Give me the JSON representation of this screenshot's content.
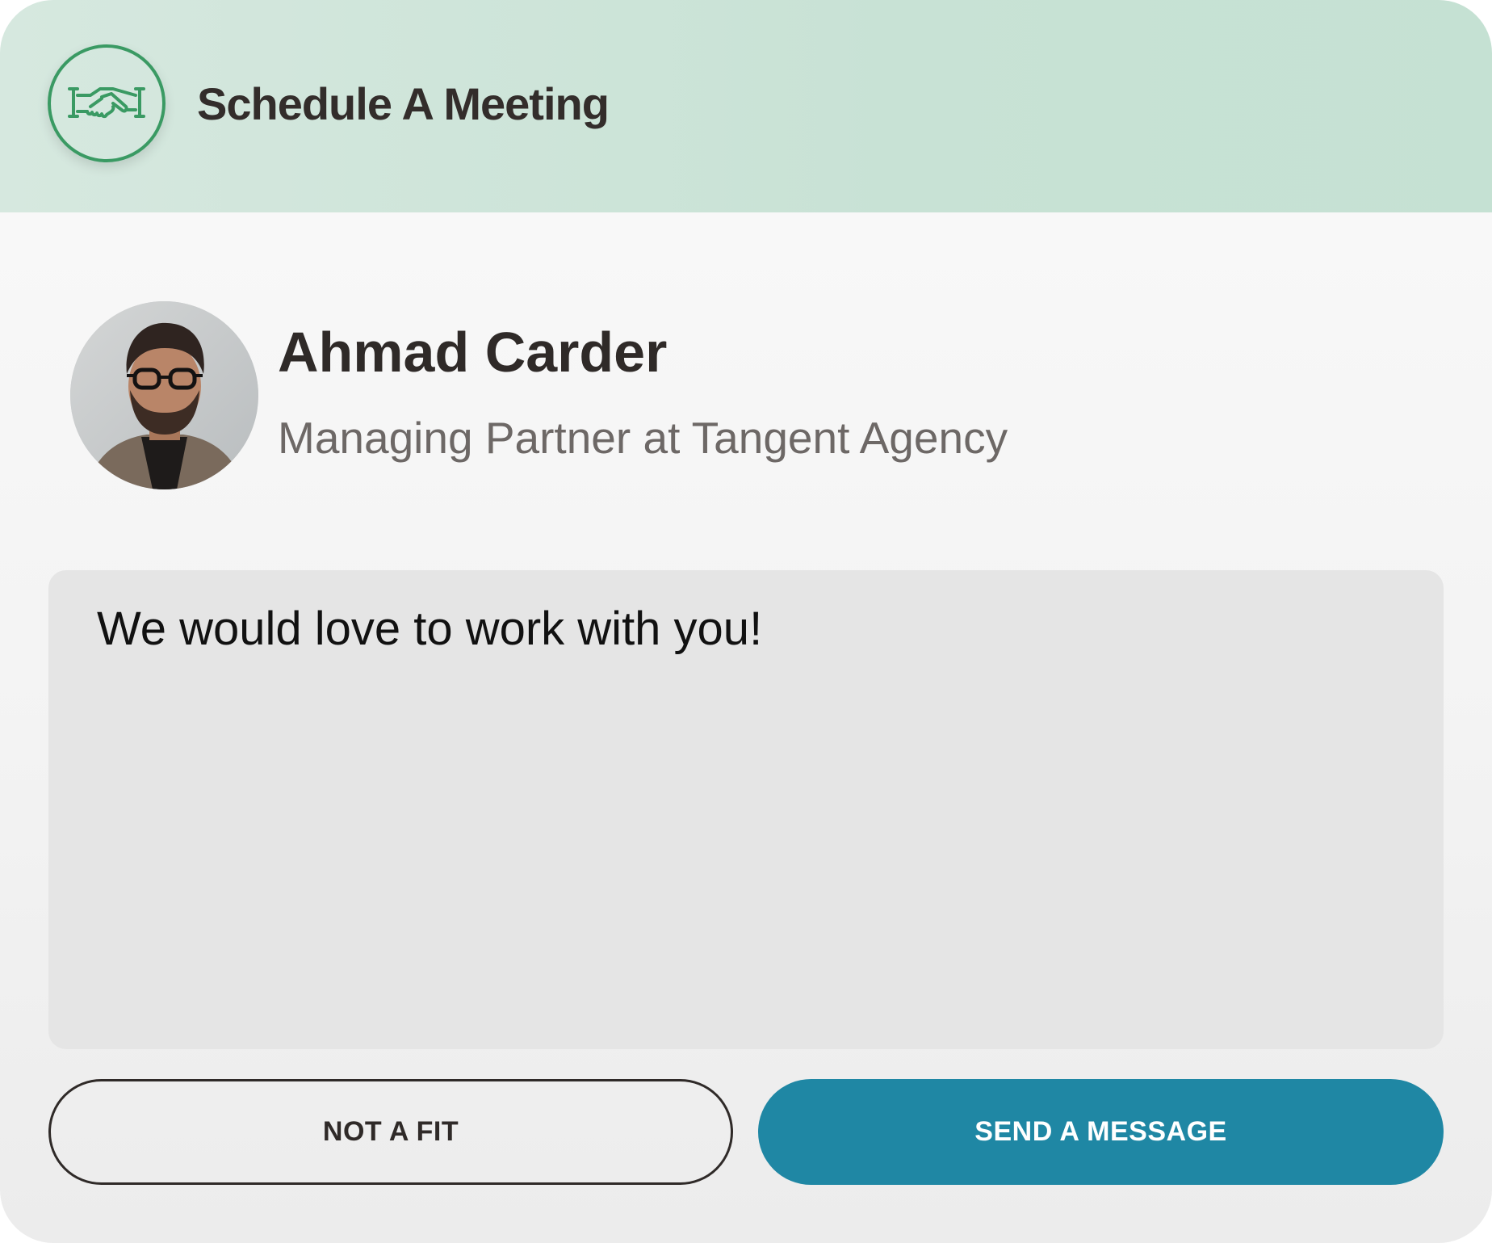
{
  "header": {
    "title": "Schedule A Meeting",
    "icon": "handshake-icon",
    "icon_color": "#3a9a63",
    "background": "#c8e2d5"
  },
  "profile": {
    "name": "Ahmad Carder",
    "role": "Managing Partner at Tangent Agency"
  },
  "message": {
    "value": "We would love to work with you!"
  },
  "actions": {
    "decline_label": "NOT A FIT",
    "send_label": "SEND A MESSAGE",
    "send_color": "#1f87a4"
  }
}
